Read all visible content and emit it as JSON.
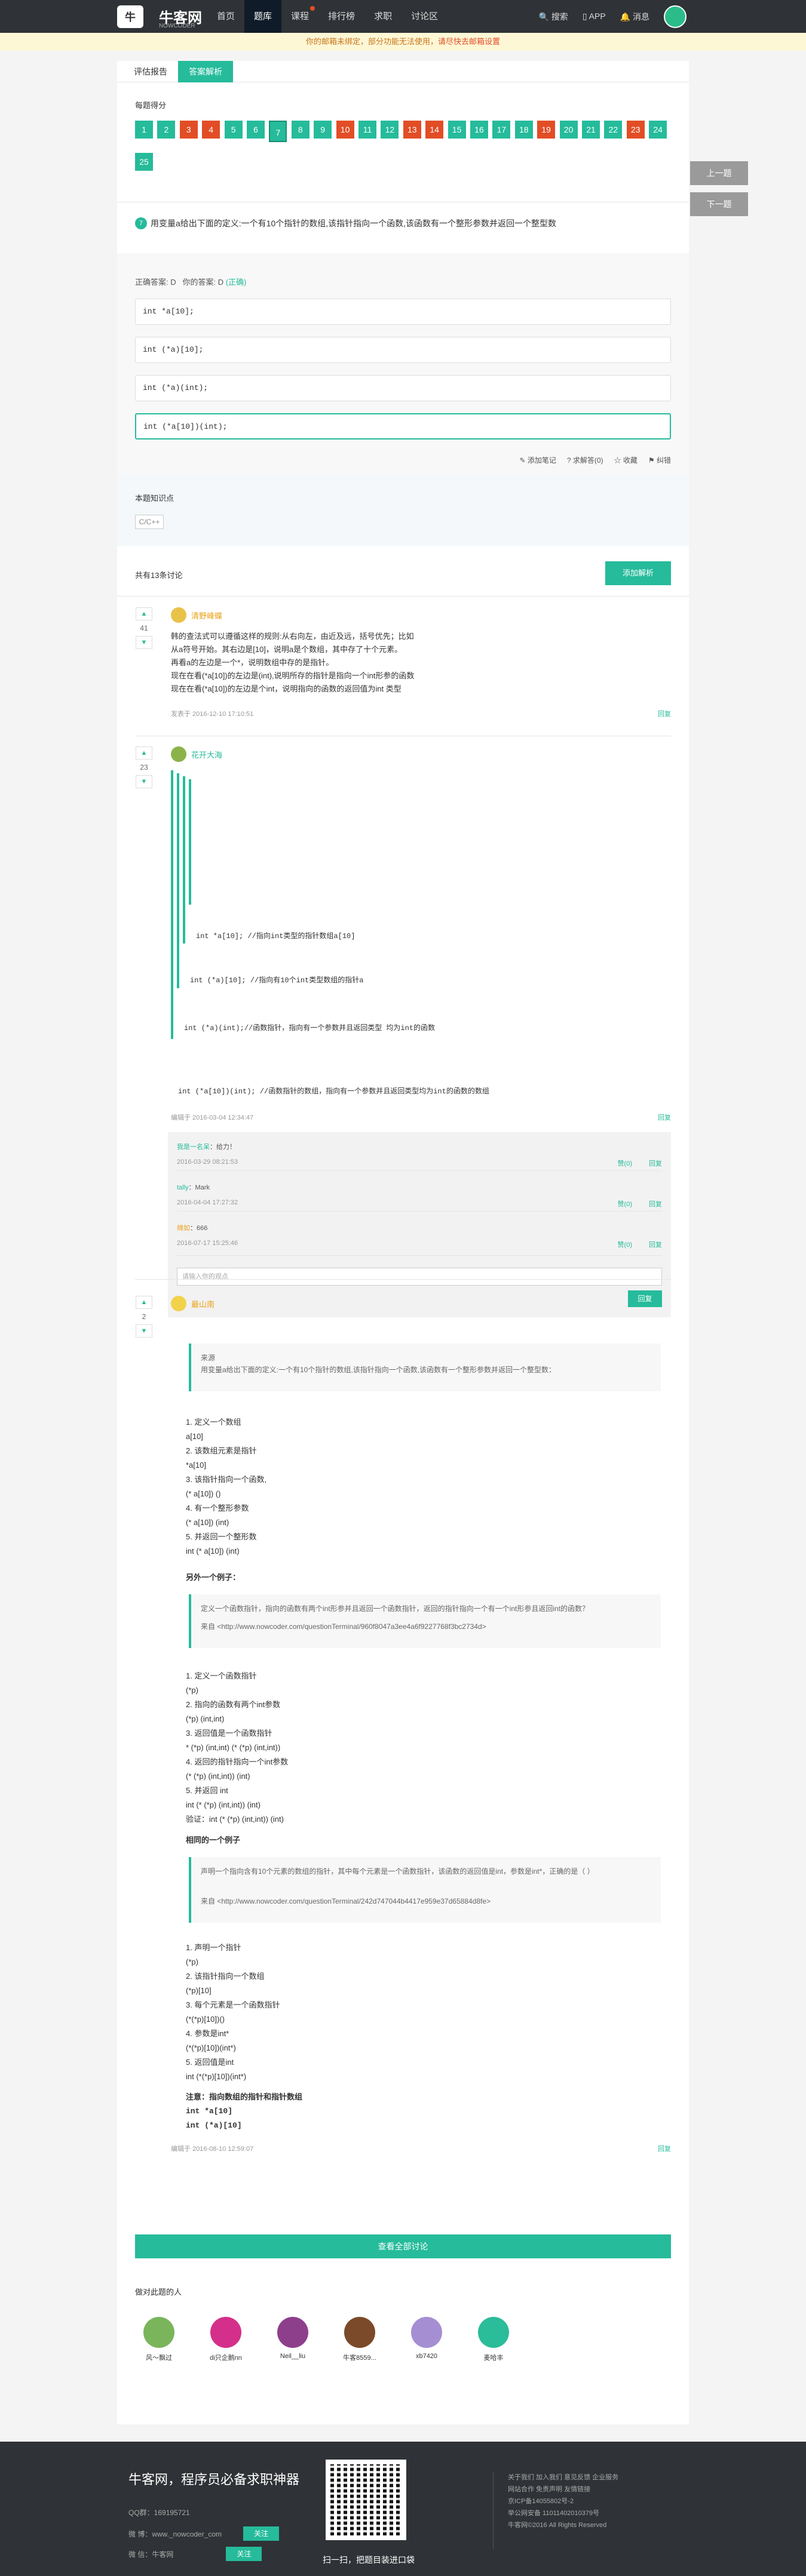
{
  "header": {
    "logo_mark": "牛",
    "brand": "牛客网",
    "brand_sub": "NOWCODER",
    "nav": [
      {
        "label": "首页"
      },
      {
        "label": "题库"
      },
      {
        "label": "课程"
      },
      {
        "label": "排行榜"
      },
      {
        "label": "求职"
      },
      {
        "label": "讨论区"
      }
    ],
    "search": "搜索",
    "app": "APP",
    "messages": "消息"
  },
  "notice": {
    "text": "你的邮箱未绑定，部分功能无法使用，",
    "link": "请尽快去邮箱设置"
  },
  "tabs": [
    "评估报告",
    "答案解析"
  ],
  "quiz": {
    "score_label": "每题得分",
    "questions": [
      {
        "n": "1",
        "status": "ok"
      },
      {
        "n": "2",
        "status": "ok"
      },
      {
        "n": "3",
        "status": "bad"
      },
      {
        "n": "4",
        "status": "bad"
      },
      {
        "n": "5",
        "status": "ok"
      },
      {
        "n": "6",
        "status": "ok"
      },
      {
        "n": "7",
        "status": "cur"
      },
      {
        "n": "8",
        "status": "ok"
      },
      {
        "n": "9",
        "status": "ok"
      },
      {
        "n": "10",
        "status": "bad"
      },
      {
        "n": "11",
        "status": "ok"
      },
      {
        "n": "12",
        "status": "ok"
      },
      {
        "n": "13",
        "status": "bad"
      },
      {
        "n": "14",
        "status": "bad"
      },
      {
        "n": "15",
        "status": "ok"
      },
      {
        "n": "16",
        "status": "ok"
      },
      {
        "n": "17",
        "status": "ok"
      },
      {
        "n": "18",
        "status": "ok"
      },
      {
        "n": "19",
        "status": "bad"
      },
      {
        "n": "20",
        "status": "ok"
      },
      {
        "n": "21",
        "status": "ok"
      },
      {
        "n": "22",
        "status": "ok"
      },
      {
        "n": "23",
        "status": "bad"
      },
      {
        "n": "24",
        "status": "ok"
      },
      {
        "n": "25",
        "status": "ok"
      }
    ],
    "qno": "7",
    "question": "用变量a给出下面的定义:一个有10个指针的数组,该指针指向一个函数,该函数有一个整形参数并返回一个整型数",
    "correct_label": "正确答案: D",
    "your_label": "你的答案: D",
    "your_status": "(正确)",
    "options": [
      "int *a[10];",
      "int (*a)[10];",
      "int (*a)(int);",
      "int (*a[10])(int);"
    ],
    "actions": [
      "添加笔记",
      "求解答(0)",
      "收藏",
      "纠错"
    ],
    "kp_label": "本题知识点",
    "kp_tag": "C/C++"
  },
  "discussion": {
    "count": "共有13条讨论",
    "add_button": "添加解析",
    "reply": "回复",
    "c1": {
      "votes": "41",
      "name": "清野峰蝶",
      "lines": [
        "韩的查法式可以遵循这样的规则:从右向左，由近及远，括号优先；比如",
        "从a符号开始。其右边是[10]，说明a是个数组，其中存了十个元素。",
        "再看a的左边是一个*，说明数组中存的是指针。",
        "现在在看(*a[10])的左边是(int),说明所存的指针是指向一个int形参的函数",
        "现在在看(*a[10])的左边是个int，说明指向的函数的返回值为int 类型"
      ],
      "meta": "发表于 2016-12-10 17:10:51"
    },
    "c2": {
      "votes": "23",
      "name": "花开大海",
      "codes": [
        "int *a[10];   //指向int类型的指针数组a[10]",
        "int (*a)[10]; //指向有10个int类型数组的指针a",
        "int (*a)(int);//函数指针，指向有一个参数并且返回类型  均为int的函数",
        "int (*a[10])(int); //函数指针的数组，指向有一个参数并且返回类型均为int的函数的数组"
      ],
      "meta": "编辑于 2016-03-04 12:34:47",
      "subs": [
        {
          "who": "我是一名呆",
          "text": "：给力！",
          "time": "2016-03-29 08:21:53",
          "like": "赞(0)"
        },
        {
          "who": "tally",
          "text": "：Mark",
          "time": "2016-04-04 17:27:32",
          "like": "赞(0)"
        },
        {
          "who": "绵如",
          "text": "：666",
          "time": "2016-07-17 15:25:46",
          "like": "赞(0)"
        }
      ],
      "reply_placeholder": "请输入你的观点",
      "reply_button": "回复"
    },
    "c3": {
      "votes": "2",
      "name": "最山南",
      "quote_title": "来源",
      "quote_text": "用变量a给出下面的定义:一个有10个指针的数组,该指针指向一个函数,该函数有一个整形参数并返回一个整型数：",
      "list1": [
        "1. 定义一个数组",
        "a[10]",
        "2. 该数组元素是指针",
        "*a[10]",
        "3. 该指针指向一个函数,",
        "(* a[10]) ()",
        "4. 有一个整形参数",
        "(* a[10]) (int)",
        "5. 并返回一个整形数",
        "int (* a[10]) (int)"
      ],
      "ex1_title": "另外一个例子：",
      "ex1_quote": "定义一个函数指针，指向的函数有两个int形参并且返回一个函数指针，返回的指针指向一个有一个int形参且返回int的函数？",
      "ex1_src": "来自 <http://www.nowcoder.com/questionTerminal/960f8047a3ee4a6f9227768f3bc2734d>",
      "list2": [
        "1. 定义一个函数指针",
        "(*p)",
        "2. 指向的函数有两个int参数",
        "(*p) (int,int)",
        "3. 返回值是一个函数指针",
        "* (*p) (int,int)        (* (*p) (int,int))",
        "4. 返回的指针指向一个int参数",
        "(* (*p) (int,int)) (int)",
        "5. 并返回 int",
        "int  (* (*p) (int,int)) (int)",
        "验证：int  (* (*p) (int,int)) (int)"
      ],
      "ex2_title": "相同的一个例子",
      "ex2_quote": "声明一个指向含有10个元素的数组的指针，其中每个元素是一个函数指针，该函数的返回值是int，参数是int*，正确的是（ ）",
      "ex2_src": "来自 <http://www.nowcoder.com/questionTerminal/242d747044b4417e959e37d65884d8fe>",
      "list3": [
        "1. 声明一个指针",
        "(*p)",
        "2. 该指针指向一个数组",
        "(*p)[10]",
        "3. 每个元素是一个函数指针",
        "(*(*p)[10])()",
        "4. 参数是int*",
        "(*(*p)[10])(int*)",
        "5. 返回值是int",
        "int (*(*p)[10])(int*)"
      ],
      "note_title": "注意：指向数组的指针和指针数组",
      "note1": "int *a[10]",
      "note2": "int (*a)[10]",
      "meta": "编辑于 2016-08-10 12:59:07"
    },
    "view_all": "查看全部讨论"
  },
  "fav": {
    "label": "做对此题的人",
    "people": [
      {
        "name": "风～飘过",
        "color": "#7ab55c"
      },
      {
        "name": "di只企鹅nn",
        "color": "#d42f8a"
      },
      {
        "name": "Neil__liu",
        "color": "#8e3f8c"
      },
      {
        "name": "牛客8559...",
        "color": "#7a4a2a"
      },
      {
        "name": "xb7420",
        "color": "#a58fd2"
      },
      {
        "name": "麦哈丰",
        "color": "#2bbc9a"
      }
    ]
  },
  "side": {
    "prev": "上一题",
    "next": "下一题"
  },
  "footer": {
    "slogan": "牛客网，程序员必备求职神器",
    "qq": "QQ群：169195721",
    "weibo_label": "微 博：www._nowcoder_com",
    "wechat_label": "微 信：牛客网",
    "follow": "关注",
    "qr_caption": "扫一扫，把题目装进口袋",
    "links": "关于我们   加入我们   意见反馈   企业服务\n网站合作   免责声明   友情链接\n京ICP备14055802号-2\n举公网安备 11011402010379号\n牛客网©2016 All Rights Reserved"
  }
}
